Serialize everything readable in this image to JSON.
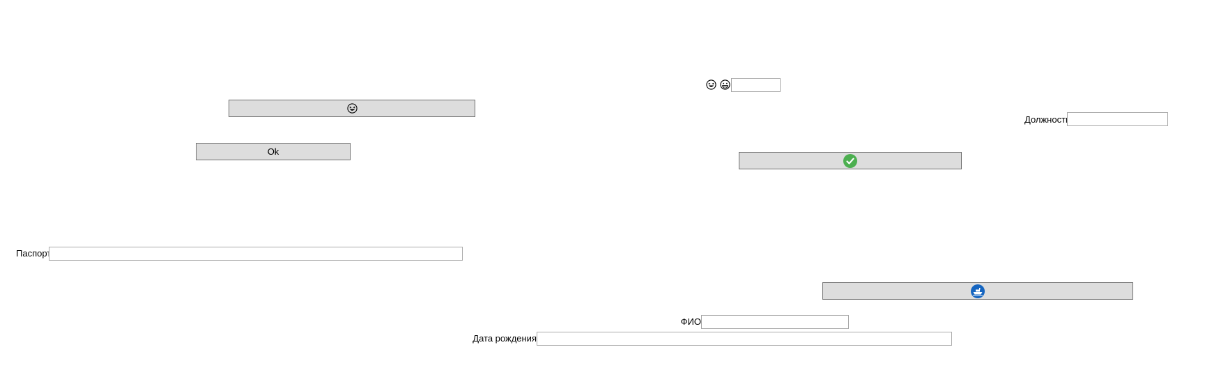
{
  "colors": {
    "button_bg": "#dddddd",
    "button_border": "#707070",
    "field_border": "#a9a9a9",
    "check_green": "#4caf50",
    "ship_blue": "#1565c0"
  },
  "buttons": {
    "emoji_wide": {
      "icon": "grinning-squint-face-icon"
    },
    "ok": {
      "label": "Ok"
    },
    "confirm": {
      "icon": "green-check-circle-icon"
    },
    "ship": {
      "icon": "ship-circle-icon"
    }
  },
  "top_center": {
    "icons": [
      "grinning-squint-face-icon",
      "grinning-face-icon"
    ],
    "input_value": ""
  },
  "fields": {
    "position": {
      "label": "Должность",
      "value": ""
    },
    "passport": {
      "label": "Паспорт",
      "value": ""
    },
    "fio": {
      "label": "ФИО",
      "value": ""
    },
    "birth_date": {
      "label": "Дата рождения",
      "value": ""
    }
  }
}
